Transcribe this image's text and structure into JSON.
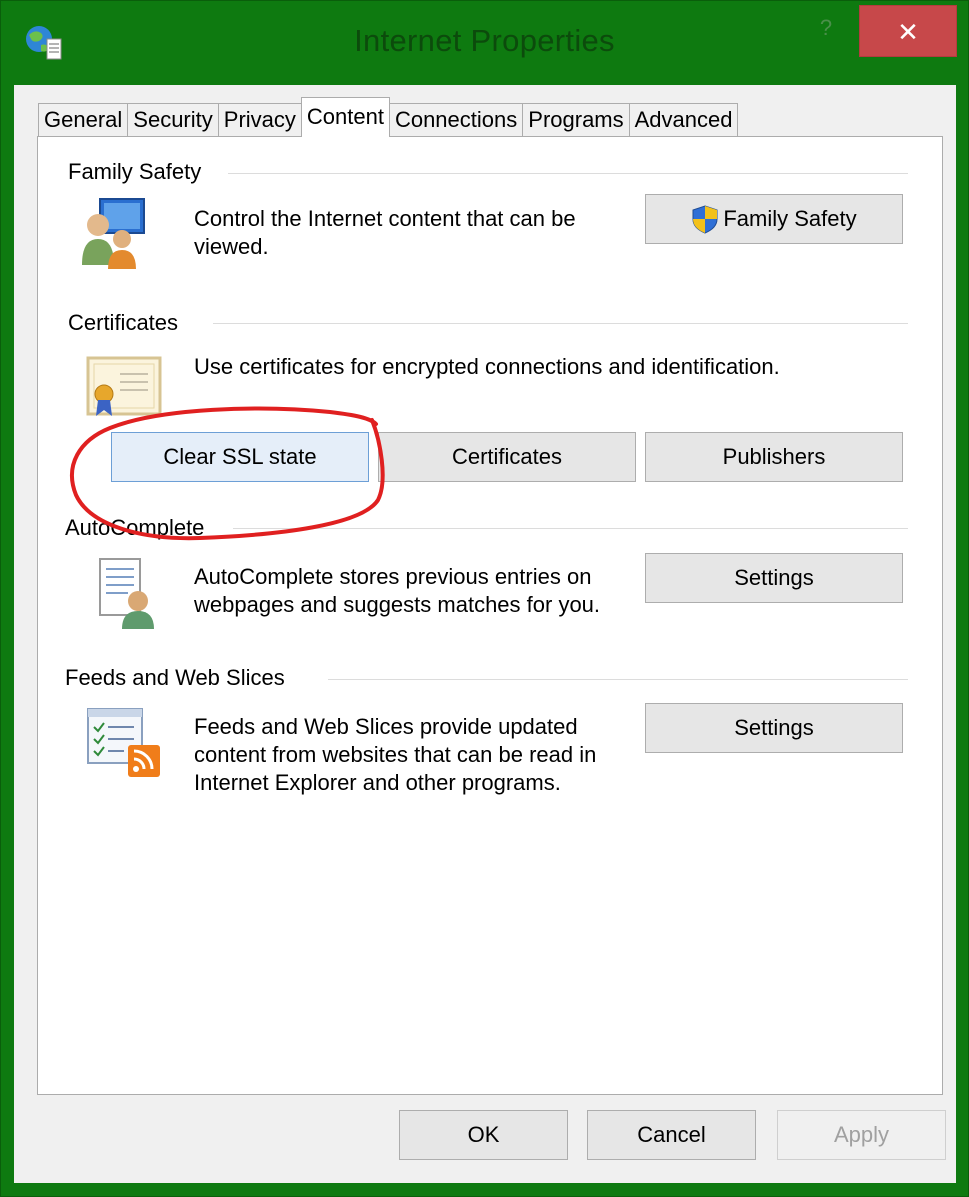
{
  "window": {
    "title": "Internet Properties",
    "help_label": "?",
    "close_label": "✕"
  },
  "tabs": [
    {
      "label": "General"
    },
    {
      "label": "Security"
    },
    {
      "label": "Privacy"
    },
    {
      "label": "Content"
    },
    {
      "label": "Connections"
    },
    {
      "label": "Programs"
    },
    {
      "label": "Advanced"
    }
  ],
  "family_safety": {
    "title": "Family Safety",
    "description": "Control the Internet content that can be viewed.",
    "button_label": "Family Safety"
  },
  "certificates": {
    "title": "Certificates",
    "description": "Use certificates for encrypted connections and identification.",
    "clear_ssl_label": "Clear SSL state",
    "certificates_label": "Certificates",
    "publishers_label": "Publishers"
  },
  "autocomplete": {
    "title": "AutoComplete",
    "description": "AutoComplete stores previous entries on webpages and suggests matches for you.",
    "settings_label": "Settings"
  },
  "feeds": {
    "title": "Feeds and Web Slices",
    "description": "Feeds and Web Slices provide updated content from websites that can be read in Internet Explorer and other programs.",
    "settings_label": "Settings"
  },
  "footer": {
    "ok_label": "OK",
    "cancel_label": "Cancel",
    "apply_label": "Apply"
  },
  "colors": {
    "frame": "#0e7a10",
    "close": "#c7484a",
    "annotation": "#e02020"
  }
}
